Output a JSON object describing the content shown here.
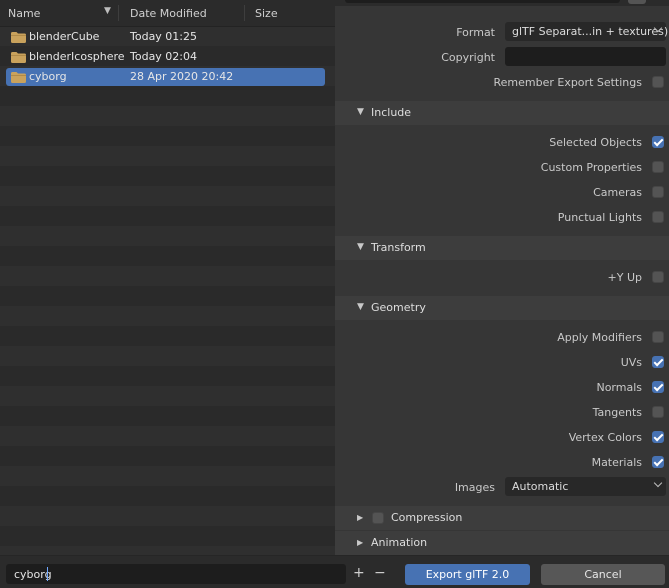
{
  "file_browser": {
    "columns": {
      "name": "Name",
      "date": "Date Modified",
      "size": "Size"
    },
    "files": [
      {
        "name": "blenderCube",
        "date": "Today 01:25",
        "selected": false
      },
      {
        "name": "blenderIcosphere",
        "date": "Today 02:04",
        "selected": false
      },
      {
        "name": "cyborg",
        "date": "28 Apr 2020 20:42",
        "selected": true
      }
    ]
  },
  "options": {
    "format": {
      "label": "Format",
      "value": "glTF Separat...in + textures)"
    },
    "copyright": {
      "label": "Copyright",
      "value": ""
    },
    "remember": {
      "label": "Remember Export Settings",
      "checked": false
    },
    "include": {
      "title": "Include",
      "items": [
        {
          "label": "Selected Objects",
          "checked": true
        },
        {
          "label": "Custom Properties",
          "checked": false
        },
        {
          "label": "Cameras",
          "checked": false
        },
        {
          "label": "Punctual Lights",
          "checked": false
        }
      ]
    },
    "transform": {
      "title": "Transform",
      "items": [
        {
          "label": "+Y Up",
          "checked": false
        }
      ]
    },
    "geometry": {
      "title": "Geometry",
      "items": [
        {
          "label": "Apply Modifiers",
          "checked": false
        },
        {
          "label": "UVs",
          "checked": true
        },
        {
          "label": "Normals",
          "checked": true
        },
        {
          "label": "Tangents",
          "checked": false
        },
        {
          "label": "Vertex Colors",
          "checked": true
        },
        {
          "label": "Materials",
          "checked": true
        }
      ],
      "images": {
        "label": "Images",
        "value": "Automatic"
      }
    },
    "compression": {
      "title": "Compression",
      "checked": false
    },
    "animation": {
      "title": "Animation"
    }
  },
  "footer": {
    "filename": "cyborg",
    "plus": "+",
    "minus": "−",
    "export_label": "Export glTF 2.0",
    "cancel_label": "Cancel"
  },
  "colors": {
    "accent": "#4772b3",
    "panel": "#363636",
    "header": "#3d3d3d"
  },
  "icons": {
    "folder": "folder-icon",
    "expanded": "triangle-down-icon",
    "collapsed": "triangle-right-icon"
  }
}
